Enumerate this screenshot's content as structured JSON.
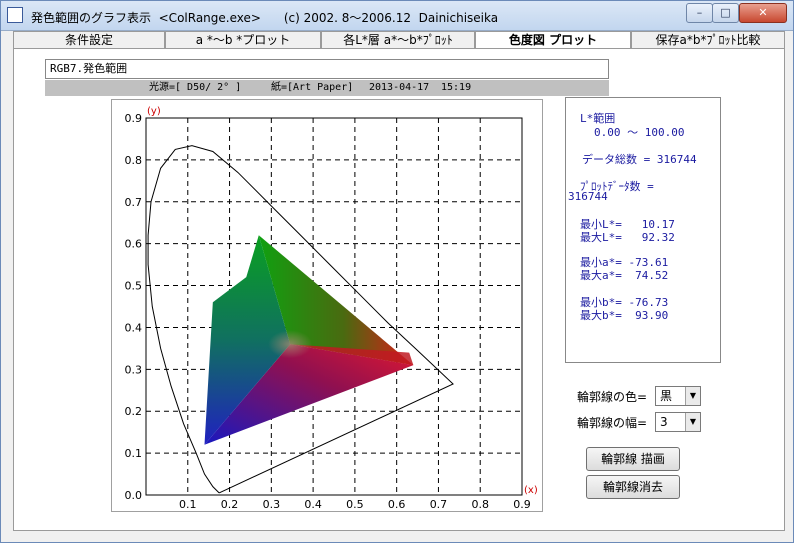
{
  "window": {
    "title": "発色範囲のグラフ表示  <ColRange.exe>      (c) 2002. 8～2006.12  Dainichiseika",
    "min_label": "–",
    "max_label": "□",
    "close_label": "✕"
  },
  "tabs": [
    {
      "label": "条件設定"
    },
    {
      "label": "a *～b *プロット"
    },
    {
      "label": "各L*層 a*～b*ﾌﾟﾛｯﾄ"
    },
    {
      "label": "色度図 プロット"
    },
    {
      "label": "保存a*b*ﾌﾟﾛｯﾄ比較"
    }
  ],
  "active_tab": 3,
  "data_name": "RGB7.発色範囲",
  "info": {
    "illuminant": "光源=[ D50/ 2° ]",
    "paper": "紙=[Art Paper]",
    "date": "2013-04-17",
    "time": "15:19"
  },
  "chart_data": {
    "type": "scatter",
    "xlabel": "(x)",
    "ylabel": "(y)",
    "xlim": [
      0,
      0.9
    ],
    "ylim": [
      0,
      0.9
    ],
    "grid": true,
    "x_ticks": [
      "0.1",
      "0.2",
      "0.3",
      "0.4",
      "0.5",
      "0.6",
      "0.7",
      "0.8",
      "0.9"
    ],
    "y_ticks": [
      "0.0",
      "0.1",
      "0.2",
      "0.3",
      "0.4",
      "0.5",
      "0.6",
      "0.7",
      "0.8",
      "0.9"
    ],
    "spectral_locus": [
      [
        0.175,
        0.005
      ],
      [
        0.16,
        0.02
      ],
      [
        0.14,
        0.05
      ],
      [
        0.12,
        0.1
      ],
      [
        0.09,
        0.17
      ],
      [
        0.06,
        0.26
      ],
      [
        0.035,
        0.35
      ],
      [
        0.015,
        0.45
      ],
      [
        0.005,
        0.55
      ],
      [
        0.005,
        0.62
      ],
      [
        0.012,
        0.7
      ],
      [
        0.035,
        0.78
      ],
      [
        0.07,
        0.825
      ],
      [
        0.11,
        0.834
      ],
      [
        0.16,
        0.82
      ],
      [
        0.22,
        0.77
      ],
      [
        0.3,
        0.69
      ],
      [
        0.37,
        0.62
      ],
      [
        0.44,
        0.55
      ],
      [
        0.51,
        0.48
      ],
      [
        0.58,
        0.41
      ],
      [
        0.65,
        0.345
      ],
      [
        0.735,
        0.265
      ],
      [
        0.175,
        0.005
      ]
    ],
    "gamut": {
      "red": [
        0.64,
        0.31
      ],
      "magenta_red": [
        0.63,
        0.34
      ],
      "green": [
        0.27,
        0.62
      ],
      "yellow_green": [
        0.24,
        0.52
      ],
      "cyan_green": [
        0.16,
        0.46
      ],
      "blue": [
        0.14,
        0.12
      ],
      "white": [
        0.345,
        0.36
      ]
    }
  },
  "stats": {
    "l_range_label": "L*範囲",
    "l_range_value": "0.00 ～ 100.00",
    "total": "データ総数 = 316744",
    "plot_count_label": "ﾌﾟﾛｯﾄﾃﾞｰﾀ数 =",
    "plot_count_value": "316744",
    "min_l": "最小L*=   10.17",
    "max_l": "最大L*=   92.32",
    "min_a": "最小a*= -73.61",
    "max_a": "最大a*=  74.52",
    "min_b": "最小b*= -76.73",
    "max_b": "最大b*=  93.90"
  },
  "controls": {
    "outline_color_label": "輪郭線の色=",
    "outline_color_value": "黒",
    "outline_width_label": "輪郭線の幅=",
    "outline_width_value": "3",
    "draw_button": "輪郭線 描画",
    "erase_button": "輪郭線消去"
  },
  "colors": {
    "stats_text": "#1a1aa0",
    "axis_label": "#cc0000",
    "info_bar": "#c0c0c0"
  }
}
